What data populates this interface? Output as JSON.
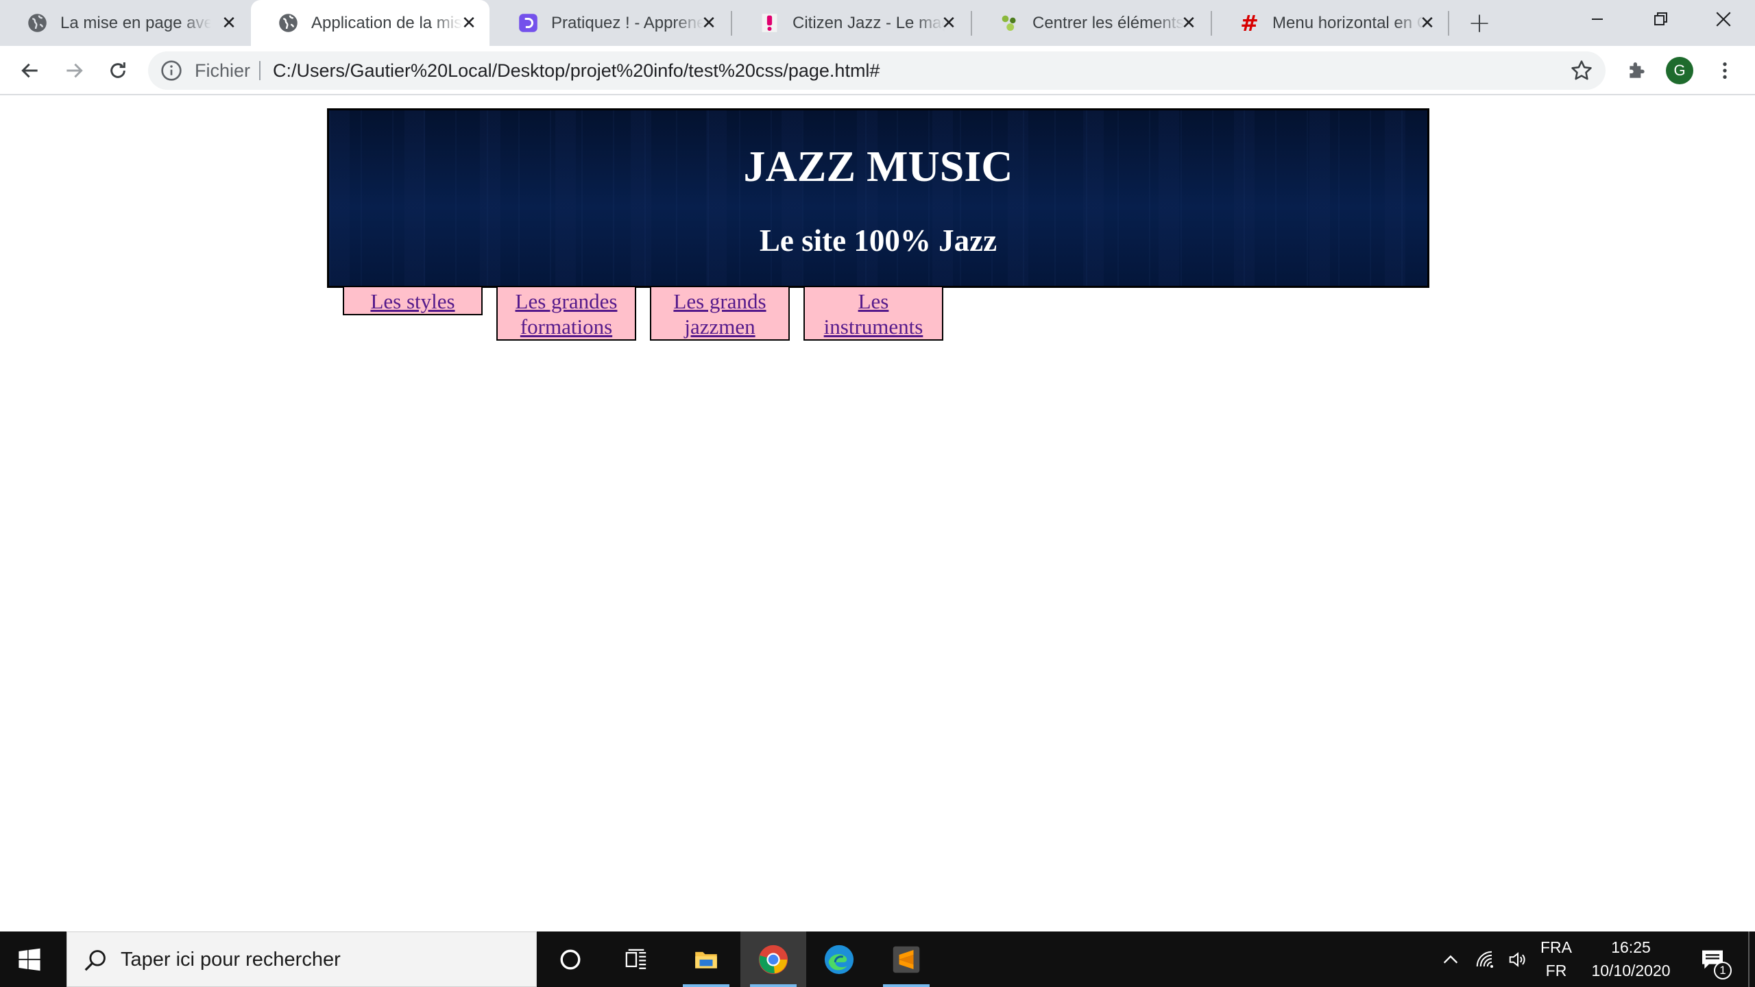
{
  "browser": {
    "tabs": [
      {
        "title": "La mise en page avec CSS",
        "icon": "globe-icon",
        "active": false
      },
      {
        "title": "Application de la mise en page",
        "icon": "globe-icon",
        "active": true
      },
      {
        "title": "Pratiquez ! - Apprenez",
        "icon": "openclassrooms-icon",
        "active": false
      },
      {
        "title": "Citizen Jazz - Le magazine",
        "icon": "citizen-jazz-icon",
        "active": false
      },
      {
        "title": "Centrer les éléments",
        "icon": "alsacreations-icon",
        "active": false
      },
      {
        "title": "Menu horizontal en CSS",
        "icon": "hash-icon",
        "active": false
      }
    ],
    "new_tab_label": "+",
    "address": {
      "scheme_label": "Fichier",
      "url": "C:/Users/Gautier%20Local/Desktop/projet%20info/test%20css/page.html#"
    },
    "profile_initial": "G"
  },
  "page": {
    "header": {
      "title": "JAZZ MUSIC",
      "subtitle": "Le site 100% Jazz"
    },
    "menu": [
      {
        "label": "Les styles"
      },
      {
        "label": "Les grandes formations"
      },
      {
        "label": "Les grands jazzmen"
      },
      {
        "label": "Les instruments"
      }
    ],
    "colors": {
      "header_bg": "#061a40",
      "menu_bg": "#ffc0cb",
      "link": "#551a8b"
    }
  },
  "taskbar": {
    "search_placeholder": "Taper ici pour rechercher",
    "apps": [
      "cortana-icon",
      "task-view-icon",
      "file-explorer-icon",
      "chrome-icon",
      "edge-icon",
      "sublime-text-icon"
    ],
    "language_top": "FRA",
    "language_bottom": "FR",
    "time": "16:25",
    "date": "10/10/2020",
    "notification_count": "1"
  }
}
